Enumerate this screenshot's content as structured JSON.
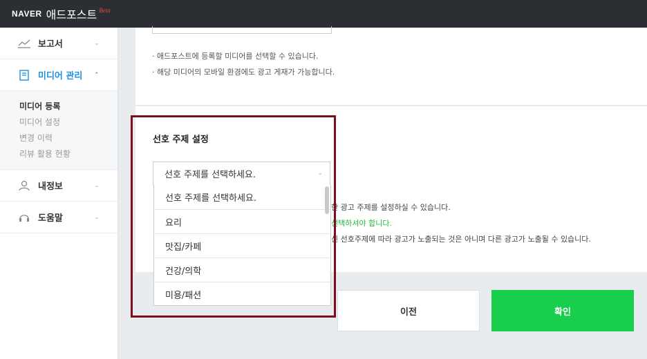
{
  "header": {
    "brand": "NAVER",
    "app_name": "애드포스트",
    "beta": "Beta"
  },
  "sidebar": {
    "items": [
      {
        "label": "보고서",
        "icon": "line-chart-icon",
        "chevron": "⌄"
      },
      {
        "label": "미디어 관리",
        "icon": "document-icon",
        "chevron": "⌃"
      },
      {
        "label": "내정보",
        "icon": "person-icon",
        "chevron": "⌄"
      },
      {
        "label": "도움말",
        "icon": "headset-icon",
        "chevron": "⌄"
      }
    ],
    "submenu": [
      "미디어 등록",
      "미디어 설정",
      "변경 이력",
      "리뷰 활용 현황"
    ]
  },
  "media_notes": [
    "· 애드포스트에 등록할 미디어를 선택할 수 있습니다.",
    "· 해당 미디어의 모바일 환경에도 광고 게재가 가능합니다."
  ],
  "topic": {
    "title": "선호 주제 설정",
    "select_value": "선호 주제를 선택하세요.",
    "info_lines": [
      "한 광고 주제를 설정하실 수 있습니다.",
      "선택하셔야 합니다.",
      "신 선호주제에 따라 광고가 노출되는 것은 아니며 다른 광고가 노출될 수 있습니다."
    ],
    "options": [
      "선호 주제를 선택하세요.",
      "요리",
      "맛집/카페",
      "건강/의학",
      "미용/패션"
    ]
  },
  "buttons": {
    "prev": "이전",
    "confirm": "확인"
  },
  "colors": {
    "accent": "#1f8fe0",
    "confirm": "#19ce4c",
    "highlight": "#7a0d1e",
    "topbar": "#2b2f33"
  }
}
